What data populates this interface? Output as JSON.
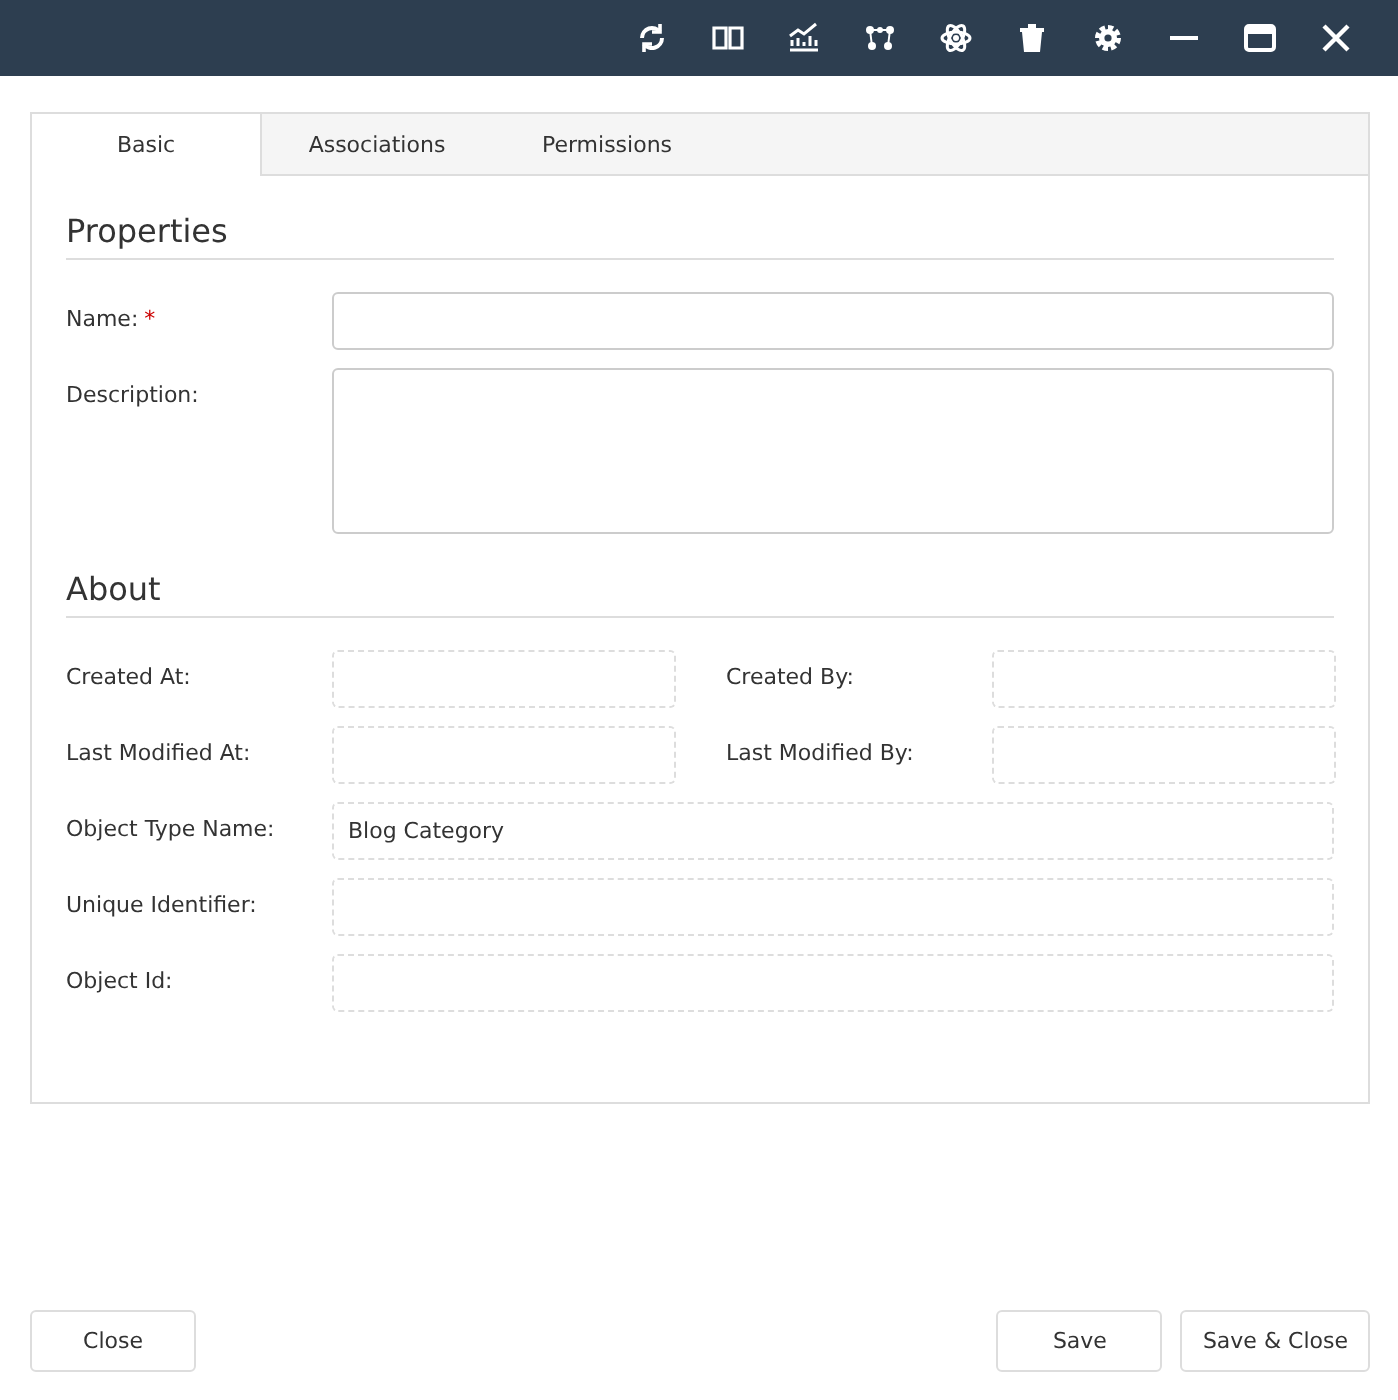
{
  "tabs": [
    {
      "label": "Basic",
      "selected": true
    },
    {
      "label": "Associations",
      "selected": false
    },
    {
      "label": "Permissions",
      "selected": false
    }
  ],
  "sections": [
    {
      "title": "Properties",
      "rows": [
        {
          "kind": "full",
          "label": "Name:",
          "required_mark": "*",
          "field": {
            "kind": "text",
            "readonly": false
          }
        },
        {
          "kind": "full",
          "label": "Description:",
          "field": {
            "kind": "textarea",
            "readonly": false
          }
        }
      ]
    },
    {
      "title": "About",
      "rows": [
        {
          "kind": "pair",
          "label": "Created At:",
          "field": {
            "kind": "text",
            "readonly": true
          },
          "label2": "Created By:",
          "field2": {
            "kind": "text",
            "readonly": true
          }
        },
        {
          "kind": "pair",
          "label": "Last Modified At:",
          "field": {
            "kind": "text",
            "readonly": true
          },
          "label2": "Last Modified By:",
          "field2": {
            "kind": "text",
            "readonly": true
          }
        },
        {
          "kind": "full",
          "label": "Object Type Name:",
          "field": {
            "kind": "text",
            "readonly": true,
            "value": "Blog Category"
          }
        },
        {
          "kind": "full",
          "label": "Unique Identifier:",
          "field": {
            "kind": "text",
            "readonly": true
          }
        },
        {
          "kind": "full",
          "label": "Object Id:",
          "field": {
            "kind": "text",
            "readonly": true
          }
        }
      ]
    }
  ],
  "footer": {
    "left": [
      "Close"
    ],
    "right": [
      "Save",
      "Save & Close"
    ]
  }
}
